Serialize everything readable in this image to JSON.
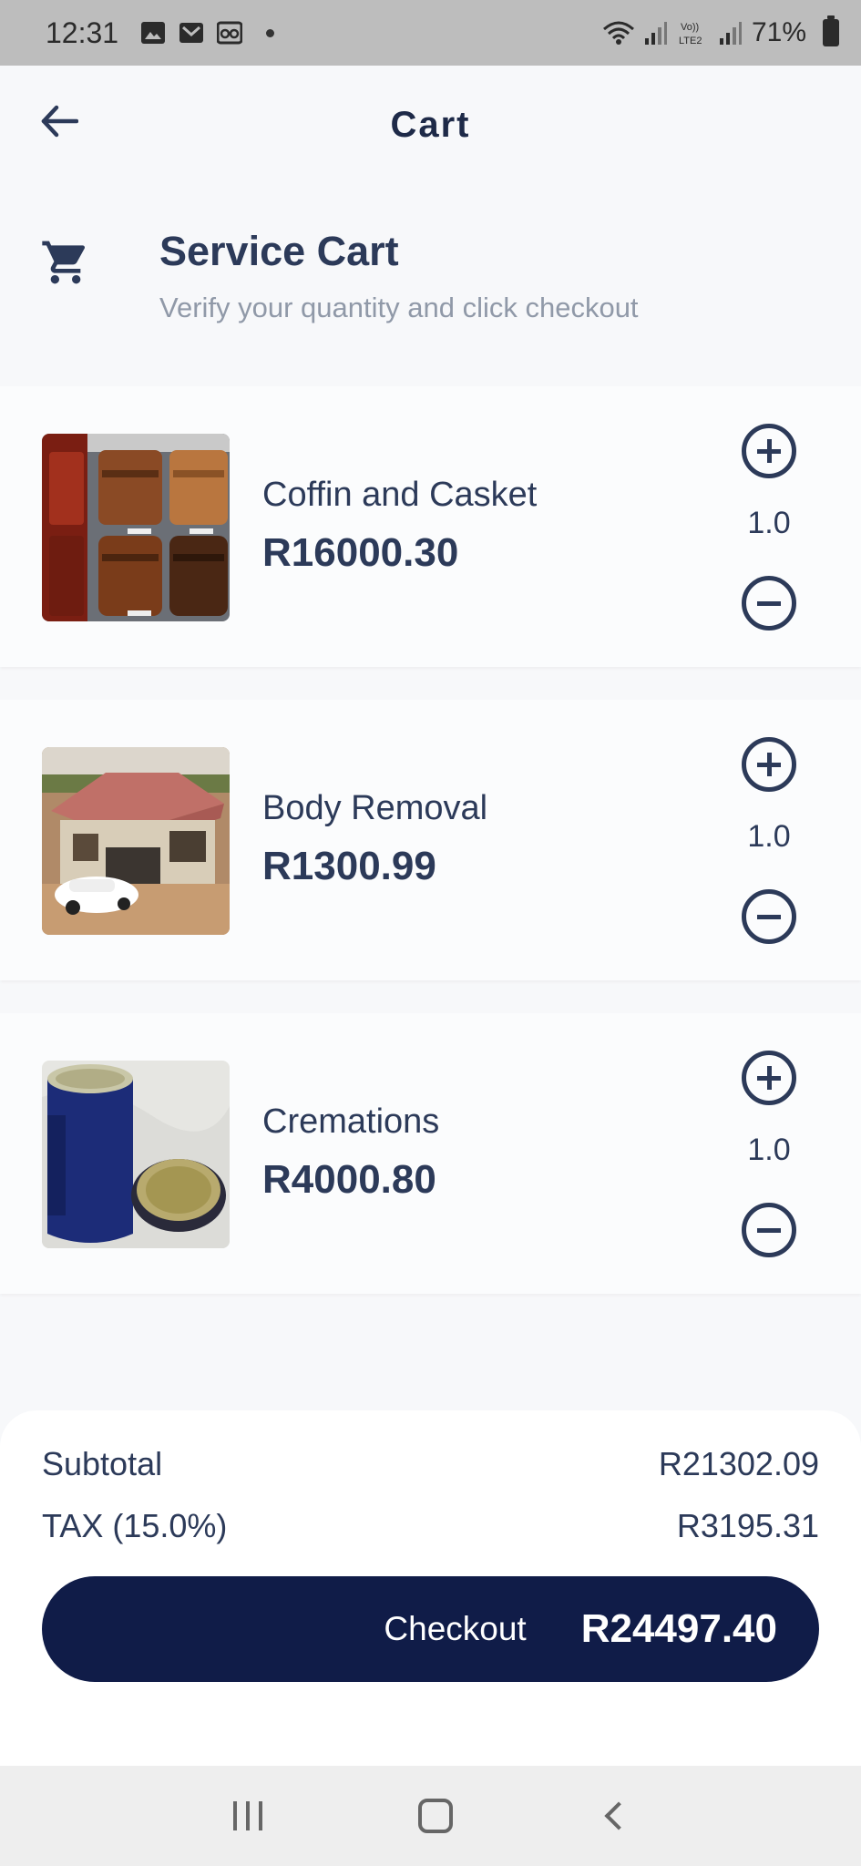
{
  "status_bar": {
    "time": "12:31",
    "battery": "71%",
    "icons": [
      "gallery-icon",
      "gmail-icon",
      "voicemail-icon",
      "wifi-icon",
      "signal-icon",
      "volte-icon",
      "signal-icon-2",
      "battery-icon"
    ]
  },
  "header": {
    "title": "Cart",
    "back_icon": "arrow-left-icon"
  },
  "section": {
    "title": "Service Cart",
    "subtitle": "Verify your quantity and click checkout",
    "icon": "shopping-cart-icon"
  },
  "items": [
    {
      "name": "Coffin and Casket",
      "price": "R16000.30",
      "quantity": "1.0",
      "image": "coffins-photo"
    },
    {
      "name": "Body Removal",
      "price": "R1300.99",
      "quantity": "1.0",
      "image": "house-with-car-photo"
    },
    {
      "name": "Cremations",
      "price": "R4000.80",
      "quantity": "1.0",
      "image": "urn-photo"
    }
  ],
  "summary": {
    "subtotal_label": "Subtotal",
    "subtotal_value": "R21302.09",
    "tax_label": "TAX (15.0%)",
    "tax_value": "R3195.31",
    "checkout_label": "Checkout",
    "checkout_total": "R24497.40"
  },
  "colors": {
    "primary": "#101c48",
    "text": "#2c3a59",
    "muted": "#9099a8",
    "background": "#f7f8fa"
  }
}
